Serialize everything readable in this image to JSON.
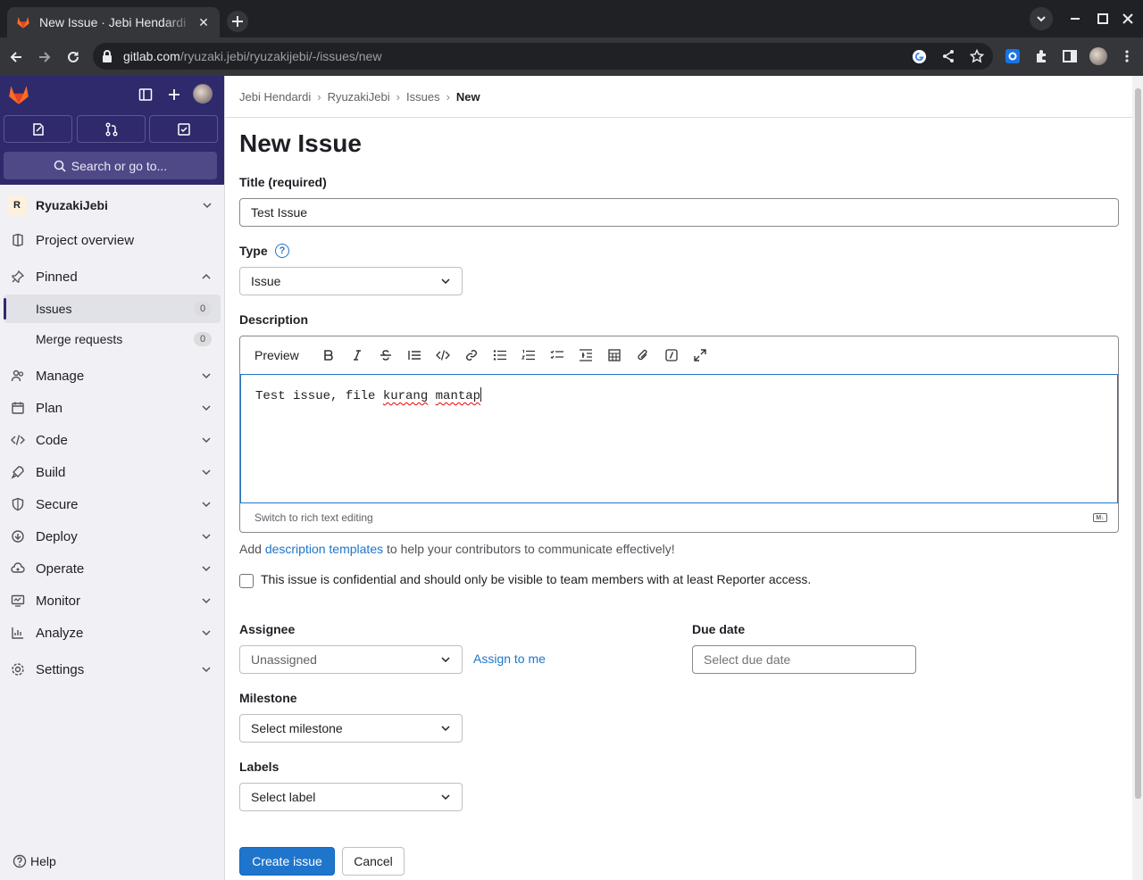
{
  "browser": {
    "tab_title": "New Issue · Jebi Hendardi",
    "url_host": "gitlab.com",
    "url_path": "/ryuzaki.jebi/ryuzakijebi/-/issues/new"
  },
  "sidebar": {
    "search_label": "Search or go to...",
    "project_initial": "R",
    "project_name": "RyuzakiJebi",
    "items": {
      "project_overview": "Project overview",
      "pinned": "Pinned",
      "issues": "Issues",
      "issues_count": "0",
      "merge_requests": "Merge requests",
      "merge_requests_count": "0",
      "manage": "Manage",
      "plan": "Plan",
      "code": "Code",
      "build": "Build",
      "secure": "Secure",
      "deploy": "Deploy",
      "operate": "Operate",
      "monitor": "Monitor",
      "analyze": "Analyze",
      "settings": "Settings"
    },
    "help": "Help"
  },
  "breadcrumb": [
    "Jebi Hendardi",
    "RyuzakiJebi",
    "Issues",
    "New"
  ],
  "page_title": "New Issue",
  "form": {
    "title_label": "Title (required)",
    "title_value": "Test Issue",
    "type_label": "Type",
    "type_help": "?",
    "type_value": "Issue",
    "description_label": "Description",
    "preview_label": "Preview",
    "description_value_plain": "Test issue, file ",
    "description_value_word1": "kurang",
    "description_value_space": " ",
    "description_value_word2": "mantap",
    "switch_editor": "Switch to rich text editing",
    "templates_prefix": "Add ",
    "templates_link": "description templates",
    "templates_suffix": " to help your contributors to communicate effectively!",
    "confidential_label": "This issue is confidential and should only be visible to team members with at least Reporter access.",
    "assignee_label": "Assignee",
    "assignee_value": "Unassigned",
    "assign_to_me": "Assign to me",
    "due_date_label": "Due date",
    "due_date_placeholder": "Select due date",
    "milestone_label": "Milestone",
    "milestone_value": "Select milestone",
    "labels_label": "Labels",
    "labels_value": "Select label",
    "create_button": "Create issue",
    "cancel_button": "Cancel"
  },
  "colors": {
    "sidebar_header": "#2f2a6b",
    "primary": "#1f75cb",
    "gitlab_orange": "#fc6d26"
  }
}
